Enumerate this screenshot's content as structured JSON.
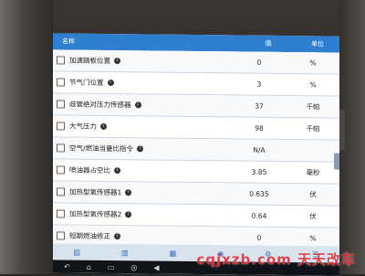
{
  "table": {
    "headers": {
      "name": "名称",
      "value": "值",
      "unit": "单位"
    },
    "rows": [
      {
        "name": "加速踏板位置",
        "value": "0",
        "unit": "%"
      },
      {
        "name": "节气门位置",
        "value": "3",
        "unit": "%"
      },
      {
        "name": "歧管绝对压力传感器",
        "value": "37",
        "unit": "千帕"
      },
      {
        "name": "大气压力",
        "value": "98",
        "unit": "千帕"
      },
      {
        "name": "空气/燃油当量比指令",
        "value": "N/A",
        "unit": ""
      },
      {
        "name": "喷油器占空比",
        "value": "3.85",
        "unit": "毫秒"
      },
      {
        "name": "加热型氧传感器1",
        "value": "0.635",
        "unit": "伏"
      },
      {
        "name": "加热型氧传感器2",
        "value": "0.64",
        "unit": "伏"
      },
      {
        "name": "短期燃油修正",
        "value": "0",
        "unit": "%"
      }
    ]
  },
  "watermark": "cqjxzb.com 天天改车",
  "colors": {
    "header": "#2f7fd0",
    "watermark": "#e0343a"
  }
}
